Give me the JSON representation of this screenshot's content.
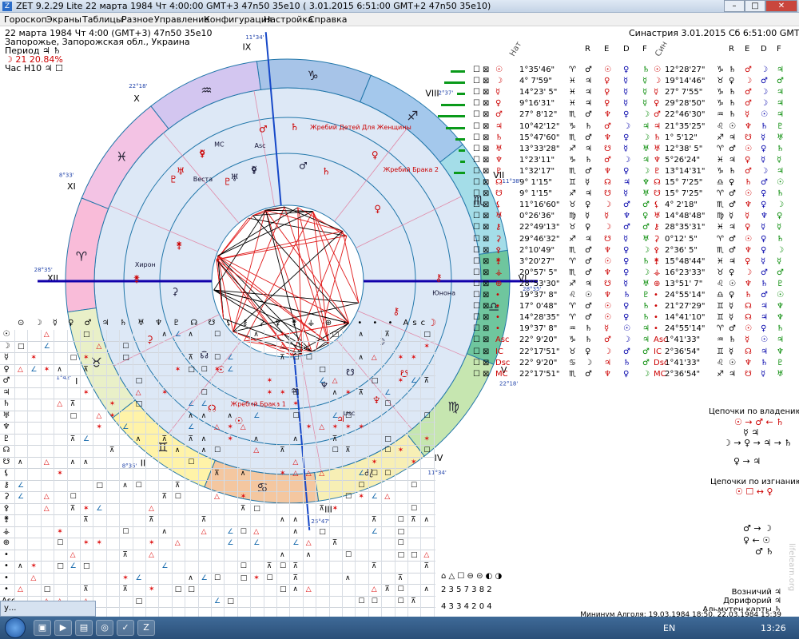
{
  "window": {
    "title": "ZET 9.2.29 Lite   22 марта 1984  Чт   4:00:00 GMT+3 47n50  35e10   ( 3.01.2015   6:51:00 GMT+2 47n50 35e10)",
    "minimize": "–",
    "maximize": "□",
    "close": "✕"
  },
  "menu": [
    "Гороскоп",
    "Экраны",
    "Таблицы",
    "Разное",
    "Управление",
    "Конфигурация",
    "Настройка",
    "Справка"
  ],
  "info_left": {
    "line1": "22 марта 1984   Чт    4:00 (GMT+3) 47n50  35e10",
    "line2": "Запорожье, Запорожская обл., Украина",
    "line3": "Период  ♃ ♄",
    "line4": "☽    21 20.84%",
    "line5": "Час Н10  ♃ ☐"
  },
  "info_right": {
    "line1": "Синастрия  3.01.2015  Сб  6:51:00 GMT+2"
  },
  "table_headers": {
    "nat": "Нат",
    "syn": "Син",
    "r": "R",
    "e": "E",
    "d": "D",
    "f": "F"
  },
  "planets": [
    {
      "glyph": "☉",
      "pos": "1°35'46\"",
      "sign": "♈",
      "r": "♂",
      "e": "☉",
      "d": "♀",
      "f": "♄",
      "sg": "☉",
      "spos": "12°28'27\"",
      "ssign": "♑",
      "sr": "♄",
      "se": "♂",
      "sd": "☽",
      "sf": "♃",
      "bar": 18
    },
    {
      "glyph": "☽",
      "pos": "4° 7'59\"",
      "sign": "♓",
      "r": "♃",
      "e": "♀",
      "d": "☿",
      "f": "☿",
      "sg": "☽",
      "spos": "19°14'46\"",
      "ssign": "♉",
      "sr": "♀",
      "se": "☽",
      "sd": "♂",
      "sf": "♂",
      "bar": 26
    },
    {
      "glyph": "☿",
      "pos": "14°23' 5\"",
      "sign": "♓",
      "r": "♃",
      "e": "♀",
      "d": "☿",
      "f": "☿",
      "sg": "☿",
      "spos": "27° 7'55\"",
      "ssign": "♑",
      "sr": "♄",
      "se": "♂",
      "sd": "☽",
      "sf": "♃",
      "bar": 10
    },
    {
      "glyph": "♀",
      "pos": "9°16'31\"",
      "sign": "♓",
      "r": "♃",
      "e": "♀",
      "d": "☿",
      "f": "☿",
      "sg": "♀",
      "spos": "29°28'50\"",
      "ssign": "♑",
      "sr": "♄",
      "se": "♂",
      "sd": "☽",
      "sf": "♃",
      "bar": 30
    },
    {
      "glyph": "♂",
      "pos": "27° 8'12\"",
      "sign": "♏",
      "r": "♂",
      "e": "♆",
      "d": "♀",
      "f": "☽",
      "sg": "♂",
      "spos": "22°46'30\"",
      "ssign": "♒",
      "sr": "♄",
      "se": "☿",
      "sd": "☉",
      "sf": "♃",
      "bar": 34
    },
    {
      "glyph": "♃",
      "pos": "10°42'12\"",
      "sign": "♑",
      "r": "♄",
      "e": "♂",
      "d": "☽",
      "f": "♃",
      "sg": "♃",
      "spos": "21°35'25\"",
      "ssign": "♌",
      "sr": "☉",
      "se": "♆",
      "sd": "♄",
      "sf": "♇",
      "bar": 24
    },
    {
      "glyph": "♄",
      "pos": "15°47'60\"",
      "sign": "♏",
      "r": "♂",
      "e": "♆",
      "d": "♀",
      "f": "☽",
      "sg": "♄",
      "spos": "1° 5'12\"",
      "ssign": "♐",
      "sr": "♃",
      "se": "☋",
      "sd": "☿",
      "sf": "♅",
      "bar": 12
    },
    {
      "glyph": "♅",
      "pos": "13°33'28\"",
      "sign": "♐",
      "r": "♃",
      "e": "☋",
      "d": "☿",
      "f": "♅",
      "sg": "♅",
      "spos": "12°38' 5\"",
      "ssign": "♈",
      "sr": "♂",
      "se": "☉",
      "sd": "♀",
      "sf": "♄",
      "bar": 8
    },
    {
      "glyph": "♆",
      "pos": "1°23'11\"",
      "sign": "♑",
      "r": "♄",
      "e": "♂",
      "d": "☽",
      "f": "♃",
      "sg": "♆",
      "spos": "5°26'24\"",
      "ssign": "♓",
      "sr": "♃",
      "se": "♀",
      "sd": "☿",
      "sf": "☿",
      "bar": 6
    },
    {
      "glyph": "♇",
      "pos": "1°32'17\"",
      "sign": "♏",
      "r": "♂",
      "e": "♆",
      "d": "♀",
      "f": "☽",
      "sg": "♇",
      "spos": "13°14'31\"",
      "ssign": "♑",
      "sr": "♄",
      "se": "♂",
      "sd": "☽",
      "sf": "♃",
      "bar": 14
    },
    {
      "glyph": "☊",
      "pos": "9° 1'15\"",
      "sign": "♊",
      "r": "☿",
      "e": "☊",
      "d": "♃",
      "f": "♆",
      "sg": "☊",
      "spos": "15° 7'25\"",
      "ssign": "♎",
      "sr": "♀",
      "se": "♄",
      "sd": "♂",
      "sf": "☉",
      "bar": 0
    },
    {
      "glyph": "☋",
      "pos": "9° 1'15\"",
      "sign": "♐",
      "r": "♃",
      "e": "☋",
      "d": "☿",
      "f": "♅",
      "sg": "☋",
      "spos": "15° 7'25\"",
      "ssign": "♈",
      "sr": "♂",
      "se": "☉",
      "sd": "♀",
      "sf": "♄",
      "bar": 0
    },
    {
      "glyph": "⚸",
      "pos": "11°16'60\"",
      "sign": "♉",
      "r": "♀",
      "e": "☽",
      "d": "♂",
      "f": "♂",
      "sg": "⚸",
      "spos": "4° 2'18\"",
      "ssign": "♏",
      "sr": "♂",
      "se": "♆",
      "sd": "♀",
      "sf": "☽",
      "bar": 0
    },
    {
      "glyph": "♅",
      "pos": "0°26'36\"",
      "sign": "♍",
      "r": "☿",
      "e": "☿",
      "d": "♆",
      "f": "♀",
      "sg": "♅",
      "spos": "14°48'48\"",
      "ssign": "♍",
      "sr": "☿",
      "se": "☿",
      "sd": "♆",
      "sf": "♀",
      "bar": 0
    },
    {
      "glyph": "⚷",
      "pos": "22°49'13\"",
      "sign": "♉",
      "r": "♀",
      "e": "☽",
      "d": "♂",
      "f": "♂",
      "sg": "⚷",
      "spos": "28°35'31\"",
      "ssign": "♓",
      "sr": "♃",
      "se": "♀",
      "sd": "☿",
      "sf": "☿",
      "bar": 0
    },
    {
      "glyph": "⚳",
      "pos": "29°46'32\"",
      "sign": "♐",
      "r": "♃",
      "e": "☋",
      "d": "☿",
      "f": "♅",
      "sg": "⚳",
      "spos": "0°12' 5\"",
      "ssign": "♈",
      "sr": "♂",
      "se": "☉",
      "sd": "♀",
      "sf": "♄",
      "bar": 0
    },
    {
      "glyph": "⚴",
      "pos": "2°10'49\"",
      "sign": "♏",
      "r": "♂",
      "e": "♆",
      "d": "♀",
      "f": "☽",
      "sg": "⚴",
      "spos": "2°36' 5\"",
      "ssign": "♏",
      "sr": "♂",
      "se": "♆",
      "sd": "♀",
      "sf": "☽",
      "bar": 0
    },
    {
      "glyph": "⚵",
      "pos": "3°20'27\"",
      "sign": "♈",
      "r": "♂",
      "e": "☉",
      "d": "♀",
      "f": "♄",
      "sg": "⚵",
      "spos": "15°48'44\"",
      "ssign": "♓",
      "sr": "♃",
      "se": "♀",
      "sd": "☿",
      "sf": "☿",
      "bar": 0
    },
    {
      "glyph": "⚶",
      "pos": "20°57' 5\"",
      "sign": "♏",
      "r": "♂",
      "e": "♆",
      "d": "♀",
      "f": "☽",
      "sg": "⚶",
      "spos": "16°23'33\"",
      "ssign": "♉",
      "sr": "♀",
      "se": "☽",
      "sd": "♂",
      "sf": "♂",
      "bar": 0
    },
    {
      "glyph": "⊕",
      "pos": "28°53'30\"",
      "sign": "♐",
      "r": "♃",
      "e": "☋",
      "d": "☿",
      "f": "♅",
      "sg": "⊕",
      "spos": "13°51' 7\"",
      "ssign": "♌",
      "sr": "☉",
      "se": "♆",
      "sd": "♄",
      "sf": "♇",
      "bar": 0
    },
    {
      "glyph": "•",
      "pos": "19°37' 8\"",
      "sign": "♌",
      "r": "☉",
      "e": "♆",
      "d": "♄",
      "f": "♇",
      "sg": "•",
      "spos": "24°55'14\"",
      "ssign": "♎",
      "sr": "♀",
      "se": "♄",
      "sd": "♂",
      "sf": "☉",
      "bar": 0
    },
    {
      "glyph": "•",
      "pos": "17° 0'48\"",
      "sign": "♈",
      "r": "♂",
      "e": "☉",
      "d": "♀",
      "f": "♄",
      "sg": "•",
      "spos": "21°27'29\"",
      "ssign": "♊",
      "sr": "☿",
      "se": "☊",
      "sd": "♃",
      "sf": "♆",
      "bar": 0
    },
    {
      "glyph": "•",
      "pos": "14°28'35\"",
      "sign": "♈",
      "r": "♂",
      "e": "☉",
      "d": "♀",
      "f": "♄",
      "sg": "•",
      "spos": "14°41'10\"",
      "ssign": "♊",
      "sr": "☿",
      "se": "☊",
      "sd": "♃",
      "sf": "♆",
      "bar": 0
    },
    {
      "glyph": "•",
      "pos": "19°37' 8\"",
      "sign": "♒",
      "r": "♄",
      "e": "☿",
      "d": "☉",
      "f": "♃",
      "sg": "•",
      "spos": "24°55'14\"",
      "ssign": "♈",
      "sr": "♂",
      "se": "☉",
      "sd": "♀",
      "sf": "♄",
      "bar": 0
    },
    {
      "glyph": "Asc",
      "pos": "22° 9'20\"",
      "sign": "♑",
      "r": "♄",
      "e": "♂",
      "d": "☽",
      "f": "♃",
      "sg": "Asc",
      "spos": "1°41'33\"",
      "ssign": "♒",
      "sr": "♄",
      "se": "☿",
      "sd": "☉",
      "sf": "♃",
      "bar": 0
    },
    {
      "glyph": "IC",
      "pos": "22°17'51\"",
      "sign": "♉",
      "r": "♀",
      "e": "☽",
      "d": "♂",
      "f": "♂",
      "sg": "IC",
      "spos": "2°36'54\"",
      "ssign": "♊",
      "sr": "☿",
      "se": "☊",
      "sd": "♃",
      "sf": "♆",
      "bar": 0
    },
    {
      "glyph": "Dsc",
      "pos": "22° 9'20\"",
      "sign": "♋",
      "r": "☽",
      "e": "♃",
      "d": "♄",
      "f": "♂",
      "sg": "Dsc",
      "spos": "1°41'33\"",
      "ssign": "♌",
      "sr": "☉",
      "se": "♆",
      "sd": "♄",
      "sf": "♇",
      "bar": 0
    },
    {
      "glyph": "MC",
      "pos": "22°17'51\"",
      "sign": "♏",
      "r": "♂",
      "e": "♆",
      "d": "♀",
      "f": "☽",
      "sg": "MC",
      "spos": "2°36'54\"",
      "ssign": "♐",
      "sr": "♃",
      "se": "☋",
      "sd": "☿",
      "sf": "♅",
      "bar": 0
    }
  ],
  "chains": {
    "title1": "Цепочки по владению",
    "line1a": "☉ → ♂ ← ♄",
    "line1b": "☿ ♃",
    "line1c": "☽ → ♀ → ♃ → ♄",
    "line1d": "♀ → ♃",
    "title2": "Цепочки по изгнанию",
    "line2a": "☉ ☐ ↔ ♀",
    "line2b": "♂ → ☽",
    "line2c": "♀ ← ☉",
    "line2d": "♂ ♄"
  },
  "right_labels": {
    "voznichiy": "Возничий  ♃",
    "doriforiy": "Дорифорий  ♃",
    "almuten": "Альмутен карты  ♄",
    "mininum": "Мининум Алголя: 19.03.1984 18:50,  22.03.1984 15:39"
  },
  "legend": {
    "top_glyphs": "⌂ △ ☐   ⊖ ⊝ ◐ ◑",
    "row1": "2  3  5    7  3  8  2",
    "row2": "4  3  3    4  2  0  4"
  },
  "chart": {
    "signs": [
      "♈",
      "♉",
      "♊",
      "♋",
      "♌",
      "♍",
      "♎",
      "♏",
      "♐",
      "♑",
      "♒",
      "♓"
    ],
    "sign_colors": [
      "#f9bcd9",
      "#e9f0c8",
      "#fff3a8",
      "#f4c7a0",
      "#f7efb5",
      "#c6e6b0",
      "#6fc69e",
      "#a4dde8",
      "#a4c8ec",
      "#a7c4e8",
      "#d3c6f0",
      "#f3c3e4"
    ],
    "house_labels": [
      "IX",
      "X",
      "XI",
      "XII",
      "I",
      "II",
      "III",
      "IV",
      "V",
      "VI",
      "VII",
      "VIII"
    ],
    "annotations": [
      "Жребий Брака 1",
      "Жребий Брака 2",
      "Жребий Детей Для Женщины",
      "Веста",
      "Юнона",
      "Хирон",
      "Asc",
      "Dsc",
      "MC"
    ],
    "degree_labels": [
      "11°34'",
      "22°18'",
      "8°33'",
      "28°35'",
      "1°42'",
      "8°35'",
      "25°47'",
      "11°34'",
      "22°18'",
      "28°35'",
      "11°38'",
      "2°37'"
    ]
  },
  "taskbar": {
    "lang": "EN",
    "time": "13:26",
    "mini_label": "у..."
  },
  "watermark": "lifelearn.org"
}
